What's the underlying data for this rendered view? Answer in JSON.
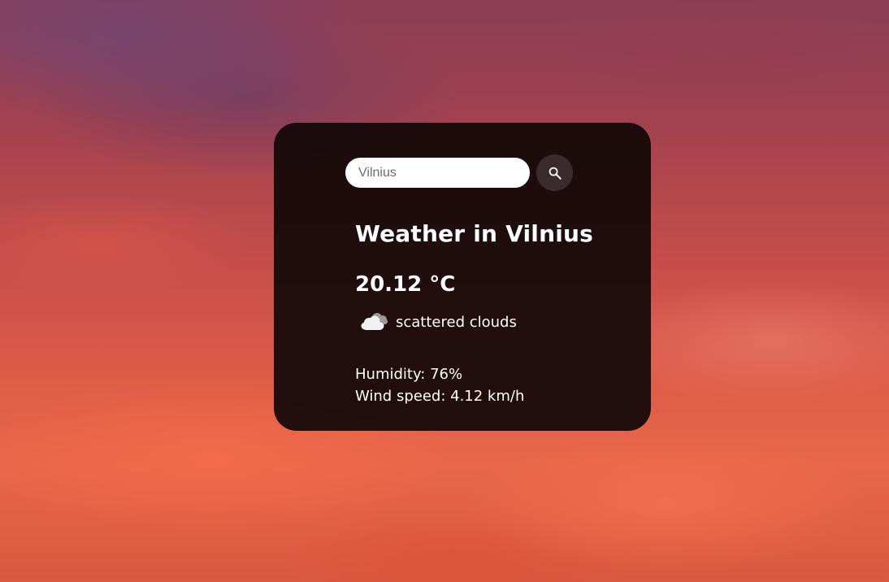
{
  "search": {
    "placeholder": "Vilnius",
    "button_icon": "search-icon"
  },
  "weather": {
    "title": "Weather in Vilnius",
    "temperature": "20.12 °C",
    "condition_icon": "scattered-clouds-icon",
    "description": "scattered clouds",
    "humidity": "Humidity: 76%",
    "wind": "Wind speed: 4.12 km/h"
  },
  "colors": {
    "card_background": "#120808",
    "text": "#ffffff",
    "search_button": "#3a2c2c"
  }
}
